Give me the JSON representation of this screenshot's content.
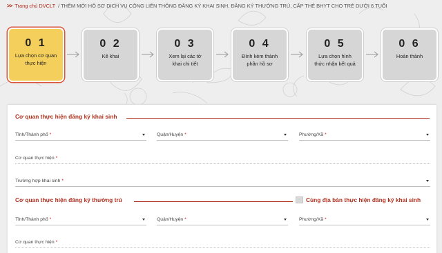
{
  "breadcrumb": {
    "home": "Trang chủ DVCLT",
    "separator": "/",
    "current": "THÊM MỚI HỒ SƠ DỊCH VỤ CÔNG LIÊN THÔNG ĐĂNG KÝ KHAI SINH, ĐĂNG KÝ THƯỜNG TRÚ, CẤP THẺ BHYT CHO TRẺ DƯỚI 6 TUỔI"
  },
  "steps": [
    {
      "num": "0 1",
      "label": "Lựa chọn cơ quan thực hiện",
      "active": true
    },
    {
      "num": "0 2",
      "label": "Kê khai",
      "active": false
    },
    {
      "num": "0 3",
      "label": "Xem lại các tờ khai chi tiết",
      "active": false
    },
    {
      "num": "0 4",
      "label": "Đính kèm thành phần hồ sơ",
      "active": false
    },
    {
      "num": "0 5",
      "label": "Lựa chọn hình thức nhận kết quả",
      "active": false
    },
    {
      "num": "0 6",
      "label": "Hoàn thành",
      "active": false
    }
  ],
  "section_birth": {
    "title": "Cơ quan thực hiện đăng ký khai sinh",
    "province": "Tỉnh/Thành phố",
    "district": "Quận/Huyện",
    "ward": "Phường/Xã",
    "agency": "Cơ quan thực hiện",
    "case": "Trường hợp khai sinh",
    "required_mark": "*"
  },
  "section_residence": {
    "title": "Cơ quan thực hiện đăng ký thường trú",
    "same_area_label": "Cùng địa bàn thực hiện đăng ký khai sinh",
    "same_area_checked": false,
    "province": "Tỉnh/Thành phố",
    "district": "Quận/Huyện",
    "ward": "Phường/Xã",
    "agency": "Cơ quan thực hiện",
    "required_mark": "*"
  },
  "colors": {
    "accent": "#b0311e",
    "active_step": "#f5cf5b",
    "active_step_border": "#d9523a",
    "inactive_step": "#d6d6d6",
    "page_background": "#efeeee"
  }
}
